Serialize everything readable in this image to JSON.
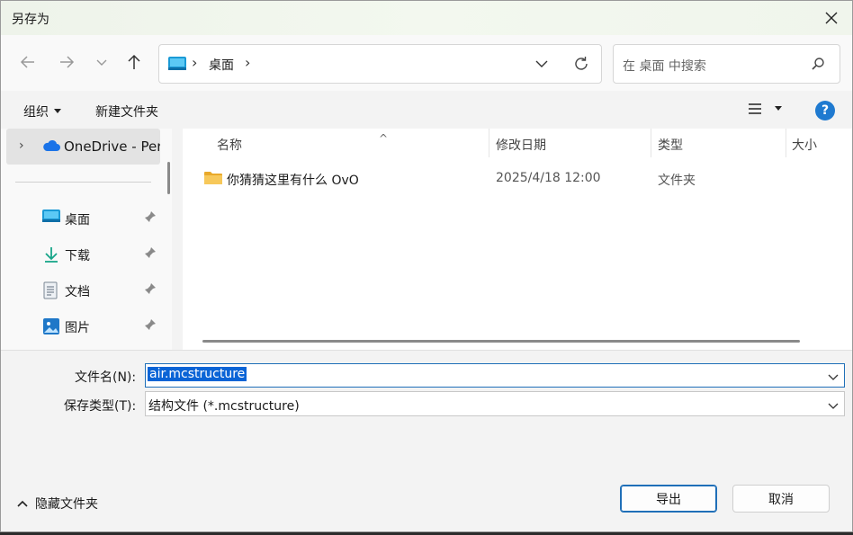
{
  "window": {
    "title": "另存为"
  },
  "nav": {
    "breadcrumb": "桌面",
    "search_placeholder": "在 桌面 中搜索"
  },
  "toolbar": {
    "organize_label": "组织",
    "new_folder_label": "新建文件夹"
  },
  "sidebar": {
    "onedrive_label": "OneDrive - Per",
    "items": [
      {
        "label": "桌面",
        "icon": "desktop-icon"
      },
      {
        "label": "下载",
        "icon": "download-icon"
      },
      {
        "label": "文档",
        "icon": "document-icon"
      },
      {
        "label": "图片",
        "icon": "pictures-icon"
      }
    ]
  },
  "columns": {
    "name": "名称",
    "modified": "修改日期",
    "type": "类型",
    "size": "大小"
  },
  "files": [
    {
      "name": "你猜猜这里有什么 OvO",
      "modified": "2025/4/18 12:00",
      "type": "文件夹",
      "icon": "folder-icon"
    }
  ],
  "form": {
    "filename_label": "文件名(N):",
    "filename_value": "air.mcstructure",
    "filetype_label": "保存类型(T):",
    "filetype_value": "结构文件 (*.mcstructure)"
  },
  "footer": {
    "hide_folders_label": "隐藏文件夹",
    "export_label": "导出",
    "cancel_label": "取消"
  },
  "colors": {
    "accent": "#1f6fb8",
    "selection": "#0a64d6",
    "folder": "#f5c04a"
  }
}
